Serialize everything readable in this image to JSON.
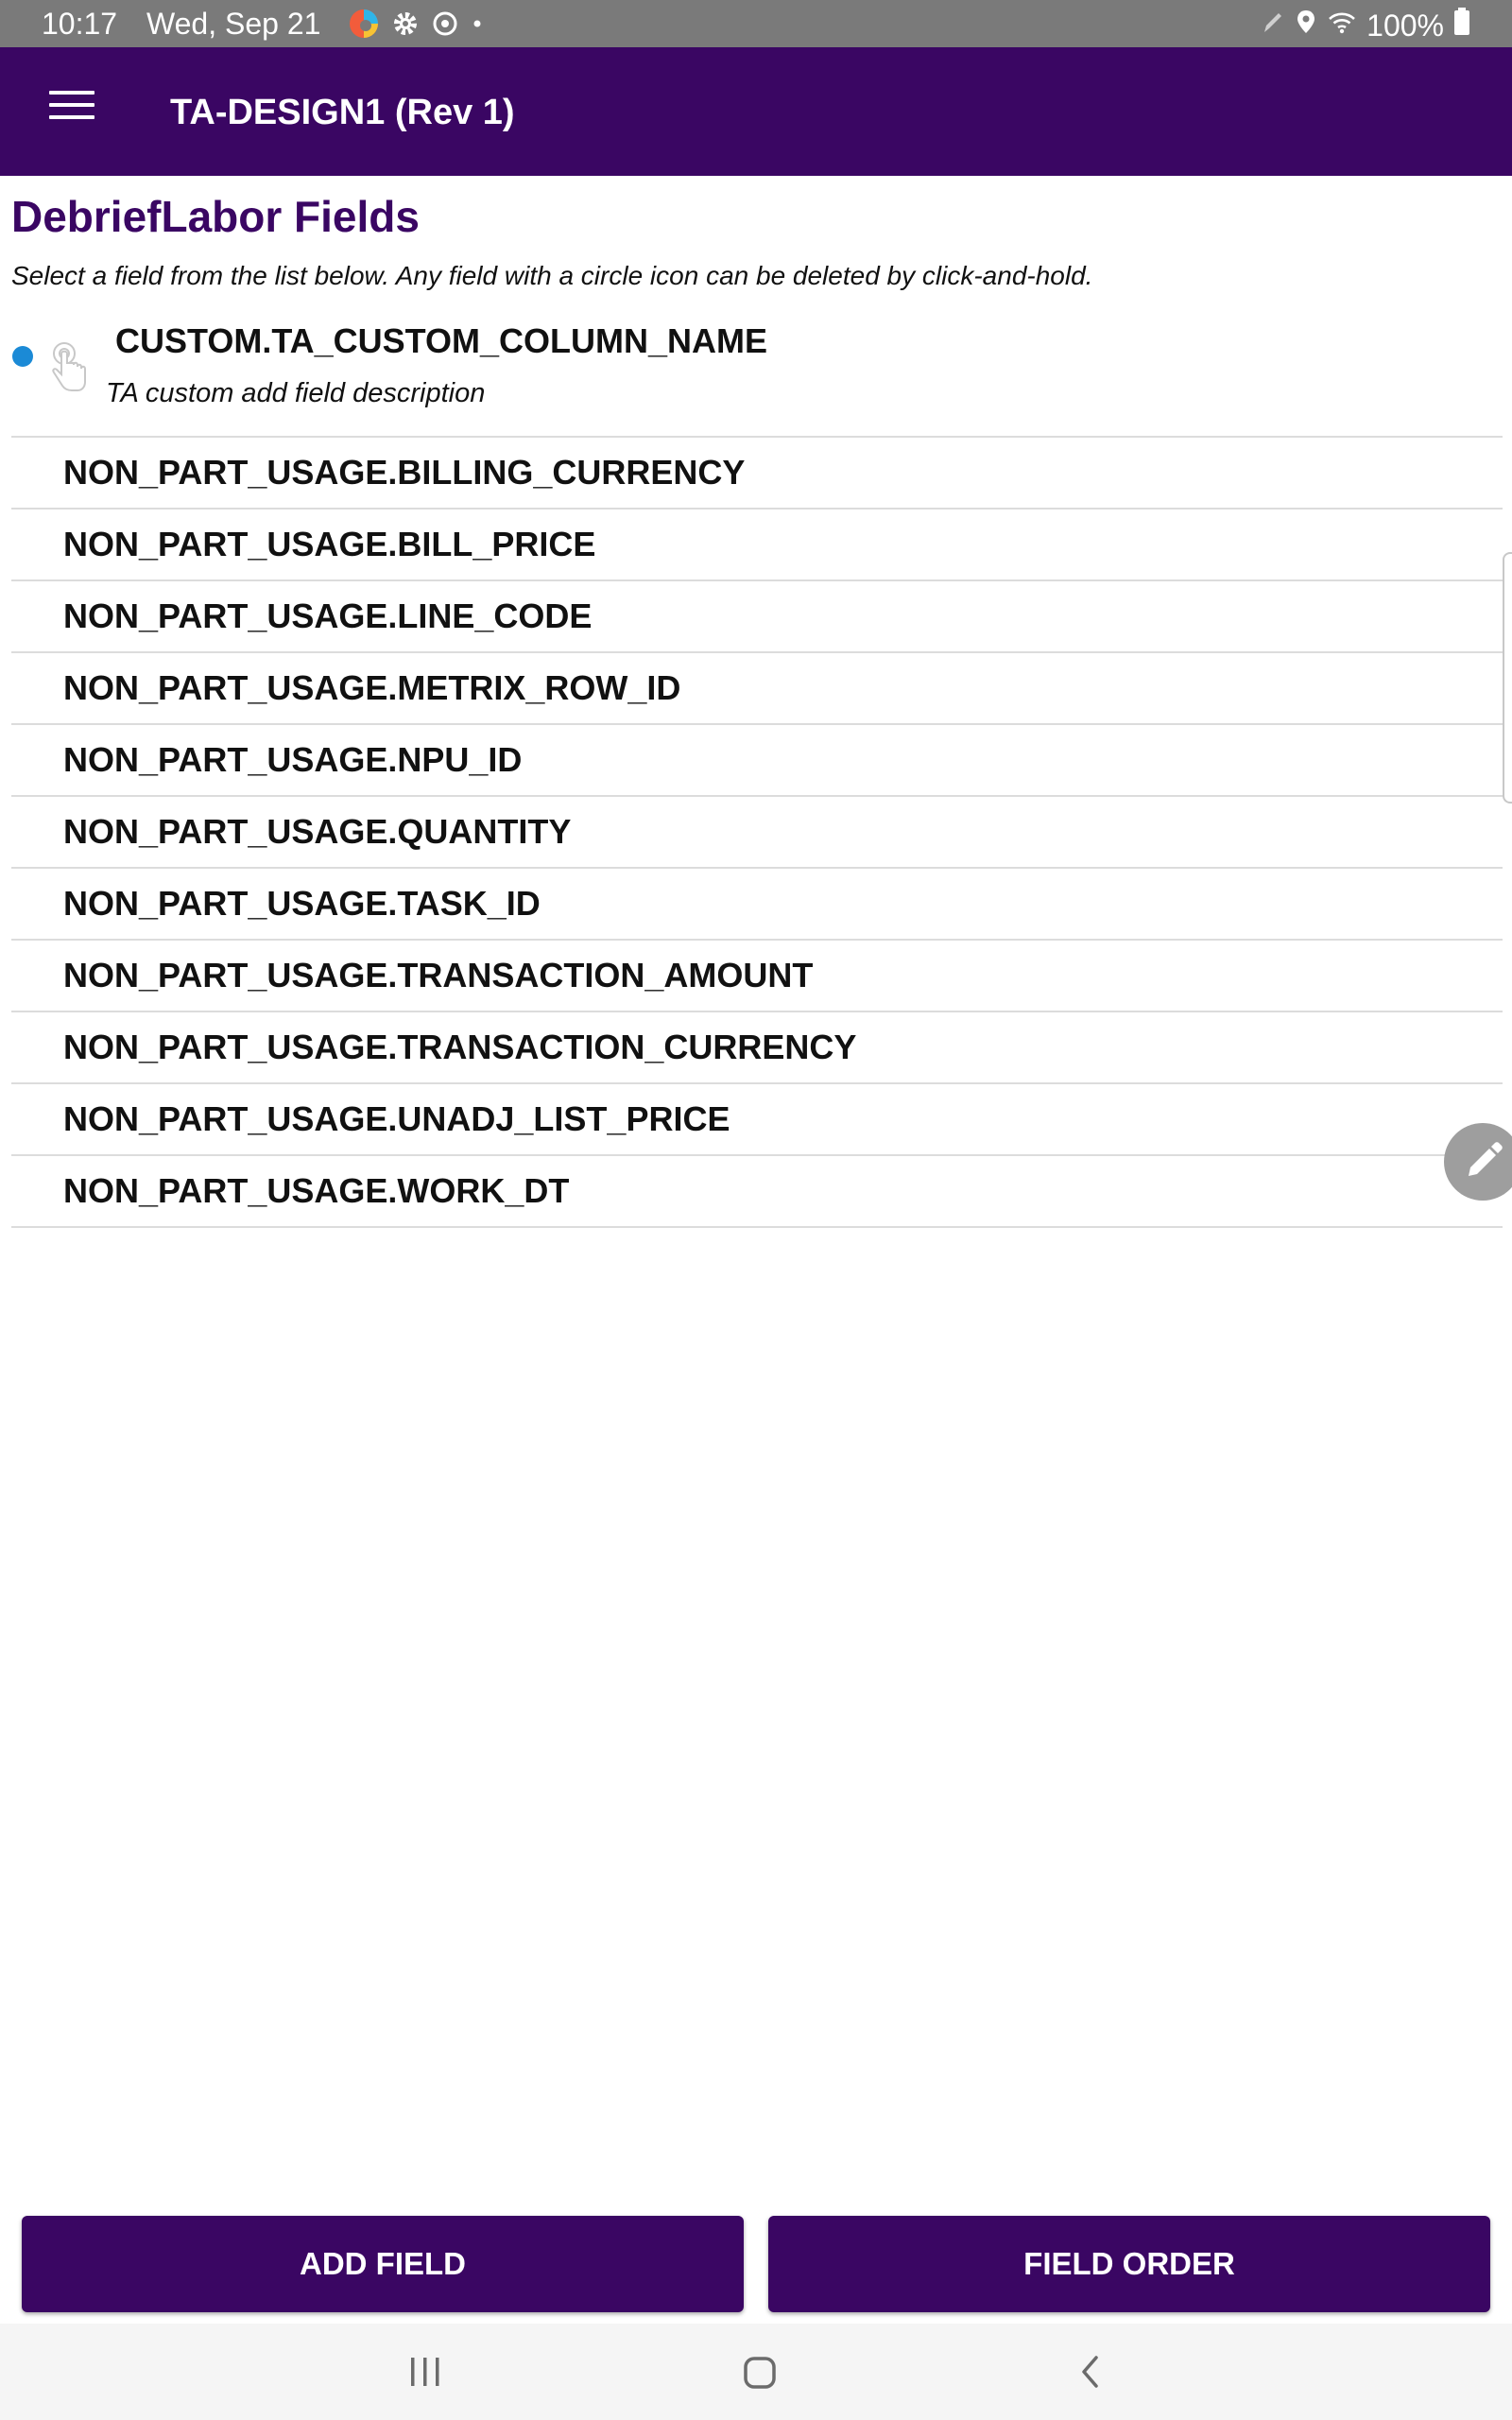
{
  "status_bar": {
    "time": "10:17",
    "date": "Wed, Sep 21",
    "battery": "100%",
    "icons_left": [
      "edge-browser-icon",
      "settings-gear-icon",
      "sync-icon",
      "dot-icon"
    ],
    "icons_right": [
      "pen-icon",
      "location-icon",
      "wifi-icon",
      "battery-icon"
    ]
  },
  "app_bar": {
    "title": "TA-DESIGN1 (Rev 1)",
    "menu_icon": "hamburger-menu-icon"
  },
  "page": {
    "title": "DebriefLabor Fields",
    "instructions": "Select a field from the list below. Any field with a circle icon can be deleted by click-and-hold."
  },
  "custom_field": {
    "name": "CUSTOM.TA_CUSTOM_COLUMN_NAME",
    "description": "TA custom add field description"
  },
  "fields": [
    "NON_PART_USAGE.BILLING_CURRENCY",
    "NON_PART_USAGE.BILL_PRICE",
    "NON_PART_USAGE.LINE_CODE",
    "NON_PART_USAGE.METRIX_ROW_ID",
    "NON_PART_USAGE.NPU_ID",
    "NON_PART_USAGE.QUANTITY",
    "NON_PART_USAGE.TASK_ID",
    "NON_PART_USAGE.TRANSACTION_AMOUNT",
    "NON_PART_USAGE.TRANSACTION_CURRENCY",
    "NON_PART_USAGE.UNADJ_LIST_PRICE",
    "NON_PART_USAGE.WORK_DT"
  ],
  "buttons": {
    "add_field": "ADD FIELD",
    "field_order": "FIELD ORDER"
  },
  "colors": {
    "primary": "#3a0663",
    "status_bar": "#7a7a7a",
    "dot": "#1b8ad6",
    "fab": "#9e9e9e"
  }
}
